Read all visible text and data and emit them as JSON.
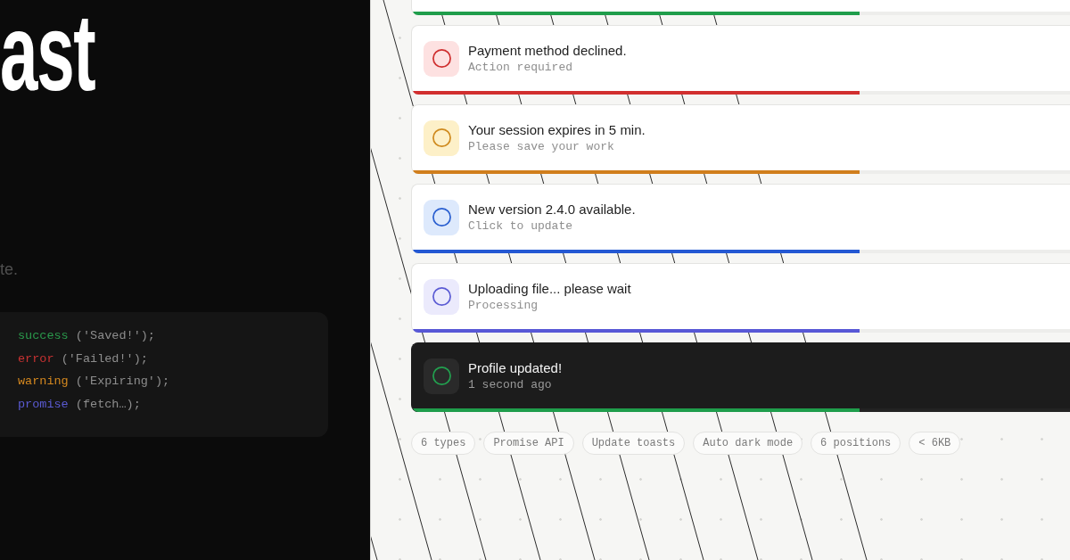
{
  "hero": {
    "title": "ast",
    "tagline": "te.",
    "code_lines": [
      {
        "kind": "success",
        "call": "success",
        "args": "('Saved!');"
      },
      {
        "kind": "error",
        "call": "error",
        "args": "('Failed!');"
      },
      {
        "kind": "warning",
        "call": "warning",
        "args": "('Expiring');"
      },
      {
        "kind": "promise",
        "call": "promise",
        "args": "(fetch…);"
      }
    ]
  },
  "toasts": [
    {
      "kind": "success",
      "dark": false,
      "level": 0.68
    },
    {
      "kind": "error",
      "dark": false,
      "title": "Payment method declined.",
      "subtitle": "Action required",
      "level": 0.68
    },
    {
      "kind": "warning",
      "dark": false,
      "title": "Your session expires in 5 min.",
      "subtitle": "Please save your work",
      "level": 0.68
    },
    {
      "kind": "info",
      "dark": false,
      "title": "New version 2.4.0 available.",
      "subtitle": "Click to update",
      "level": 0.68
    },
    {
      "kind": "loading",
      "dark": false,
      "title": "Uploading file... please wait",
      "subtitle": "Processing",
      "level": 0.68
    },
    {
      "kind": "success",
      "dark": true,
      "title": "Profile updated!",
      "subtitle": "1 second ago",
      "level": 0.68
    }
  ],
  "features": [
    "6 types",
    "Promise API",
    "Update toasts",
    "Auto dark mode",
    "6 positions",
    "< 6KB"
  ]
}
